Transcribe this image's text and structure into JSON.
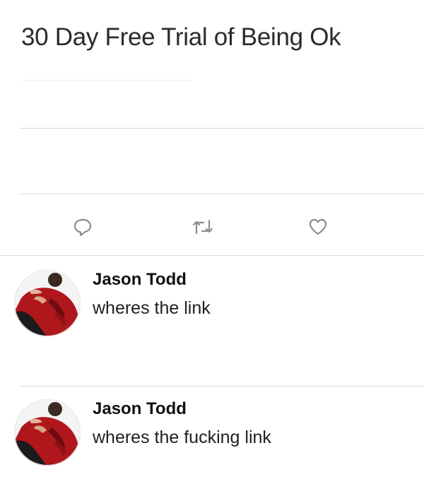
{
  "tweet": {
    "text": "30 Day Free Trial of Being Ok"
  },
  "actions": {
    "reply_icon": "reply-bubble-icon",
    "retweet_icon": "retweet-icon",
    "like_icon": "heart-icon",
    "icon_color": "#8a8d91"
  },
  "replies": [
    {
      "name": "Jason Todd",
      "text": "wheres the link",
      "avatar_icon": "avatar-red-hoodie"
    },
    {
      "name": "Jason Todd",
      "text": "wheres the fucking link",
      "avatar_icon": "avatar-red-hoodie"
    }
  ],
  "colors": {
    "hoodie": "#b0171c",
    "hoodie_shadow": "#6e0c10",
    "divider": "#d9dadb"
  }
}
